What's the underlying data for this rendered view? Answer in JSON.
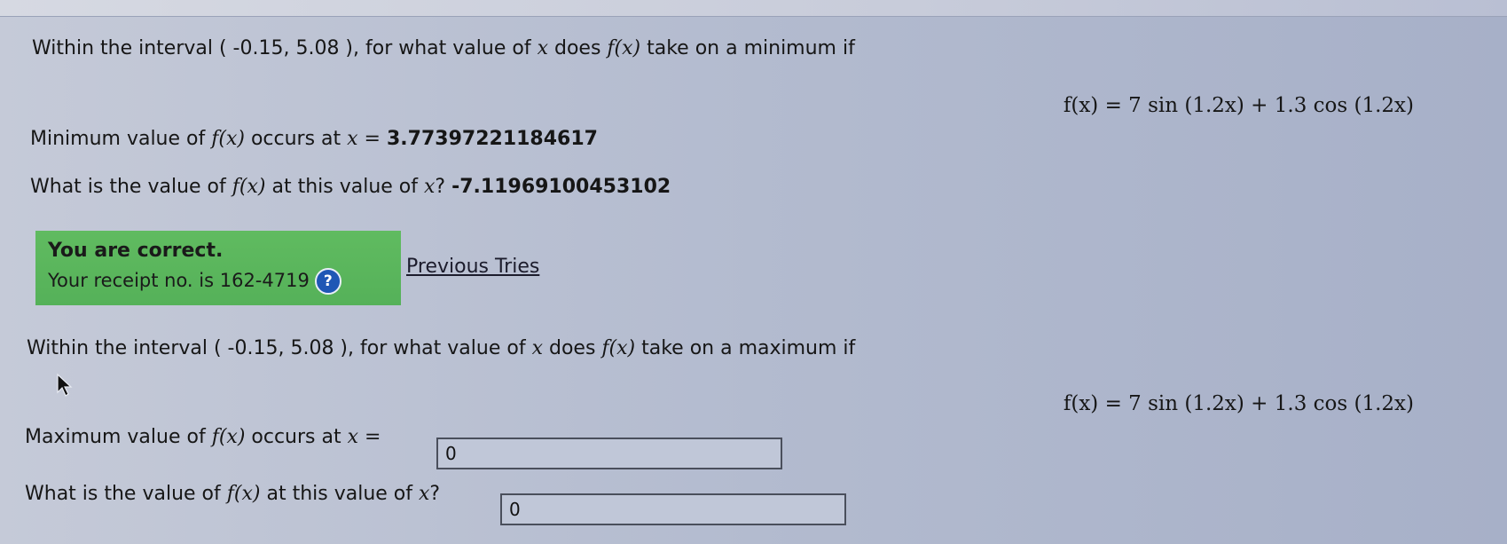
{
  "q1": {
    "prompt_a": "Within the interval ( -0.15, 5.08 ), for what value of ",
    "var_x": "x",
    "prompt_b": " does ",
    "fx": "f(x)",
    "prompt_c": " take on a minimum if",
    "formula": "f(x) = 7 sin (1.2x) + 1.3 cos (1.2x)",
    "min_label_a": "Minimum value of ",
    "min_label_b": " occurs at ",
    "eq": "x =",
    "min_answer": "3.77397221184617",
    "val_label_a": "What is the value of ",
    "val_label_b": " at this value of ",
    "val_label_c": "?",
    "val_answer": "-7.11969100453102"
  },
  "feedback": {
    "line1": "You are correct.",
    "line2": "Your receipt no. is 162-4719",
    "help_glyph": "?",
    "previous_tries": "Previous Tries"
  },
  "q2": {
    "prompt_a": "Within the interval ( -0.15, 5.08 ), for what value of ",
    "var_x": "x",
    "prompt_b": " does ",
    "fx": "f(x)",
    "prompt_c": " take on a maximum if",
    "formula": "f(x) = 7 sin (1.2x) + 1.3 cos (1.2x)",
    "max_label_a": "Maximum value of ",
    "max_label_b": " occurs at ",
    "eq": "x =",
    "max_input_value": "0",
    "val_label_a": "What is the value of ",
    "val_label_b": " at this value of ",
    "val_label_c": "?",
    "val_input_value": "0"
  },
  "icons": {
    "help": "help-circle-icon",
    "cursor": "mouse-pointer-icon"
  },
  "colors": {
    "feedback_bg": "#5cb85c",
    "help_icon": "#1f57b5"
  }
}
